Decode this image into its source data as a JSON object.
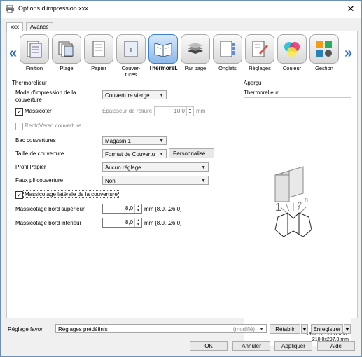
{
  "window": {
    "title": "Options d'impression xxx"
  },
  "tabs": [
    "xxx",
    "Avancé"
  ],
  "categories": [
    {
      "label": "Finition"
    },
    {
      "label": "Plage"
    },
    {
      "label": "Papier"
    },
    {
      "label": "Couver-\ntures"
    },
    {
      "label": "Thermorel."
    },
    {
      "label": "Par page"
    },
    {
      "label": "Onglets"
    },
    {
      "label": "Réglages"
    },
    {
      "label": "Couleur"
    },
    {
      "label": "Gestion"
    }
  ],
  "section": {
    "title": "Thermorelieur",
    "mode_label": "Mode d'impression de la couverture",
    "mode_value": "Couverture vierge",
    "massicoter_label": "Massicoter",
    "epaisseur_label": "Épaisseur de reliure",
    "epaisseur_value": "10,0",
    "epaisseur_unit": "mm",
    "rectoverso_label": "RectoVerso couverture",
    "bac_label": "Bac couvertures",
    "bac_value": "Magasin 1",
    "taille_label": "Taille de couverture",
    "taille_value": "Format de Couvertu",
    "personnalise_label": "Personnalisé...",
    "profil_label": "Profil Papier",
    "profil_value": "Aucun réglage",
    "faux_label": "Faux pli couverture",
    "faux_value": "Non",
    "massicotage_lat_label": "Massicotage latérale de la couverture",
    "sup_label": "Massicotage bord supérieur",
    "sup_value": "8,0",
    "sup_range": "mm [8.0...26.0]",
    "inf_label": "Massicotage bord inférieur",
    "inf_value": "8,0",
    "inf_range": "mm [8.0...26.0]"
  },
  "preview": {
    "title": "Aperçu",
    "subtitle": "Thermorelieur",
    "size_label": "Taille de couverture",
    "size_value": "210.0x297,0 mm",
    "pages": [
      "1",
      "2",
      "n"
    ]
  },
  "bottom": {
    "favori_label": "Réglage favori",
    "favori_value": "Réglages prédéfinis",
    "favori_state": "(modifié)",
    "retablir": "Rétablir",
    "enregistrer": "Enregistrer",
    "ok": "OK",
    "annuler": "Annuler",
    "appliquer": "Appliquer",
    "aide": "Aide"
  },
  "nav": {
    "left": "«",
    "right": "»"
  }
}
